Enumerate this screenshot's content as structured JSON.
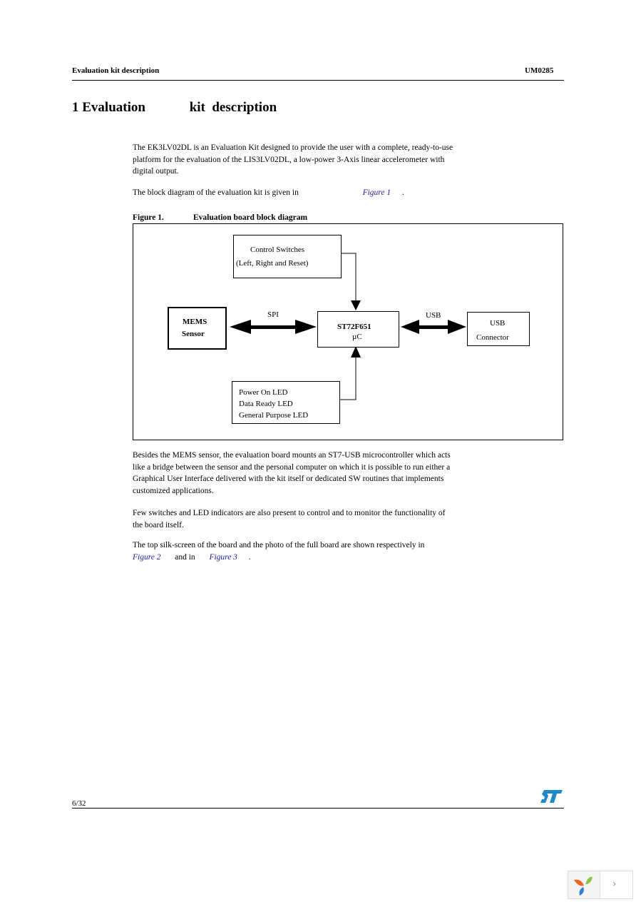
{
  "header": {
    "section": "Evaluation kit description",
    "doc_id": "UM0285"
  },
  "section_title": "1 Evaluation             kit  description",
  "paragraphs": {
    "p1": "The EK3LV02DL is an Evaluation Kit designed to provide the user with a complete, ready-to-use platform for the evaluation of the LIS3LV02DL, a low-power 3-Axis linear accelerometer with digital output.",
    "p2_before": "The block diagram of the evaluation kit is given in",
    "p2_link": "Figure 1",
    "p2_after": ".",
    "p3": "Besides the MEMS sensor, the evaluation board mounts an ST7-USB microcontroller which acts like a bridge between the sensor and the personal computer on which it is possible to run either a Graphical User Interface delivered with the kit itself or dedicated SW routines that implements customized applications.",
    "p4": "Few switches and LED indicators are also present to control and to monitor the functionality of the board itself.",
    "p5_before": "The top silk-screen of the board and the photo of the full board are shown respectively in",
    "p5_link1": "Figure 2",
    "p5_mid": "and in",
    "p5_link2": "Figure 3",
    "p5_after": "."
  },
  "figure": {
    "number": "Figure 1.",
    "title": "Evaluation board block diagram",
    "blocks": {
      "control": {
        "line1": "Control Switches",
        "line2": "(Left, Right and Reset)"
      },
      "mems": {
        "line1": "MEMS",
        "line2": "Sensor"
      },
      "mcu": {
        "line1": "ST72F651",
        "line2": "µC"
      },
      "usb": {
        "line1": "USB",
        "line2": "Connector"
      },
      "leds": {
        "line1": "Power On LED",
        "line2": "Data Ready LED",
        "line3": "General Purpose LED"
      }
    },
    "labels": {
      "spi": "SPI",
      "usb": "USB"
    }
  },
  "footer": {
    "page": "6/32",
    "logo": "ST"
  },
  "colors": {
    "link": "#1a1aa6",
    "logo": "#1e88c8"
  }
}
